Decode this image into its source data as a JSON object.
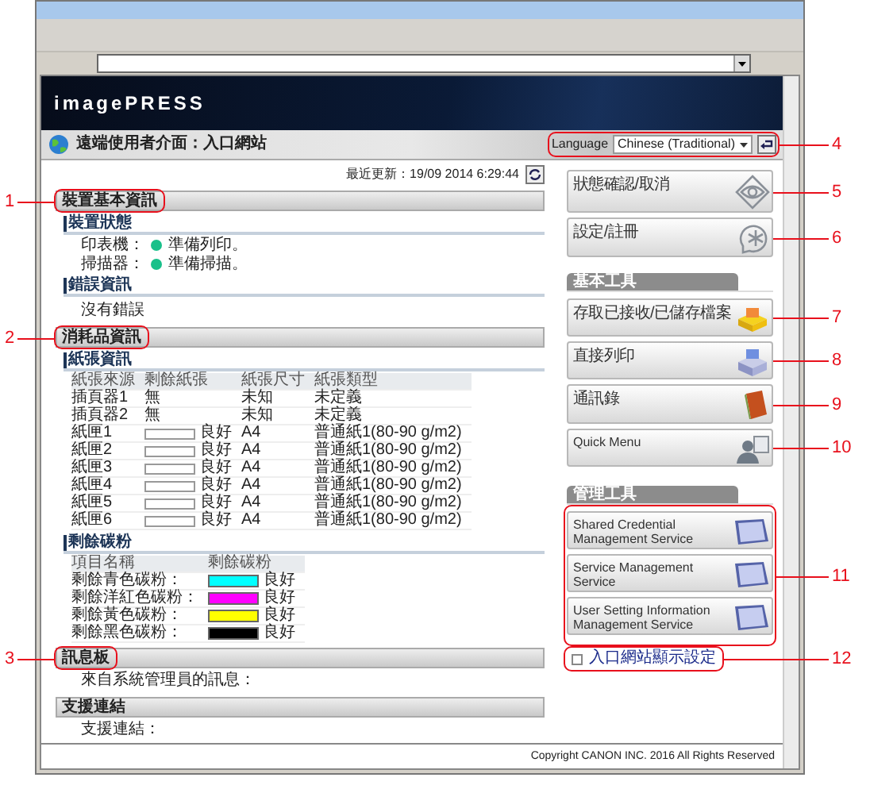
{
  "header": {
    "product": "imagePRESS",
    "title": "遠端使用者介面：入口網站",
    "language": {
      "label": "Language",
      "value": "Chinese (Traditional)",
      "callout": {
        "number": "4",
        "outlined": true
      }
    }
  },
  "last_update": "最近更新：19/09 2014 6:29:44",
  "sections": [
    {
      "title": "裝置基本資訊",
      "callout": {
        "number": "1",
        "outlined": true
      },
      "blocks": [
        {
          "kind": "status",
          "title": "裝置狀態",
          "rows": [
            {
              "label": "印表機：",
              "status": "準備列印。"
            },
            {
              "label": "掃描器：",
              "status": "準備掃描。"
            }
          ]
        },
        {
          "kind": "text",
          "title": "錯誤資訊",
          "text": "沒有錯誤"
        }
      ]
    },
    {
      "title": "消耗品資訊",
      "callout": {
        "number": "2",
        "outlined": true
      },
      "blocks": [
        {
          "kind": "paper",
          "title": "紙張資訊",
          "columns": [
            "紙張來源",
            "剩餘紙張",
            "紙張尺寸",
            "紙張類型"
          ],
          "rows": [
            {
              "source": "插頁器1",
              "remaining": "無",
              "size": "未知",
              "type": "未定義"
            },
            {
              "source": "插頁器2",
              "remaining": "無",
              "size": "未知",
              "type": "未定義"
            },
            {
              "source": "紙匣1",
              "gauge": true,
              "remaining": "良好",
              "size": "A4",
              "type": "普通紙1(80-90 g/m2)"
            },
            {
              "source": "紙匣2",
              "gauge": true,
              "remaining": "良好",
              "size": "A4",
              "type": "普通紙1(80-90 g/m2)"
            },
            {
              "source": "紙匣3",
              "gauge": true,
              "remaining": "良好",
              "size": "A4",
              "type": "普通紙1(80-90 g/m2)"
            },
            {
              "source": "紙匣4",
              "gauge": true,
              "remaining": "良好",
              "size": "A4",
              "type": "普通紙1(80-90 g/m2)"
            },
            {
              "source": "紙匣5",
              "gauge": true,
              "remaining": "良好",
              "size": "A4",
              "type": "普通紙1(80-90 g/m2)"
            },
            {
              "source": "紙匣6",
              "gauge": true,
              "remaining": "良好",
              "size": "A4",
              "type": "普通紙1(80-90 g/m2)"
            }
          ]
        },
        {
          "kind": "toner",
          "title": "剩餘碳粉",
          "columns": [
            "項目名稱",
            "剩餘碳粉"
          ],
          "rows": [
            {
              "name": "剩餘青色碳粉：",
              "color": "#00ffff",
              "level": 1,
              "status": "良好"
            },
            {
              "name": "剩餘洋紅色碳粉：",
              "color": "#ff00ff",
              "level": 1,
              "status": "良好"
            },
            {
              "name": "剩餘黃色碳粉：",
              "color": "#ffff00",
              "level": 1,
              "status": "良好"
            },
            {
              "name": "剩餘黑色碳粉：",
              "color": "#000000",
              "level": 1,
              "status": "良好"
            }
          ]
        }
      ]
    },
    {
      "title": "訊息板",
      "callout": {
        "number": "3",
        "outlined": true
      },
      "blocks": [
        {
          "kind": "plain",
          "text": "來自系統管理員的訊息："
        }
      ]
    },
    {
      "title": "支援連結",
      "blocks": [
        {
          "kind": "plain",
          "text": "支援連結："
        }
      ]
    }
  ],
  "right": {
    "buttons": [
      {
        "label": "狀態確認/取消",
        "callout": {
          "number": "5"
        }
      },
      {
        "label": "設定/註冊",
        "callout": {
          "number": "6"
        }
      }
    ],
    "groups": [
      {
        "title": "基本工具",
        "buttons": [
          {
            "label": "存取已接收/已儲存檔案",
            "callout": {
              "number": "7"
            }
          },
          {
            "label": "直接列印",
            "callout": {
              "number": "8"
            }
          },
          {
            "label": "通訊錄",
            "callout": {
              "number": "9"
            }
          },
          {
            "label": "Quick Menu",
            "callout": {
              "number": "10"
            }
          }
        ]
      },
      {
        "title": "管理工具",
        "callout": {
          "number": "11",
          "outlined": true
        },
        "buttons": [
          {
            "label": "Shared Credential Management Service"
          },
          {
            "label": "Service Management Service"
          },
          {
            "label": "User Setting Information Management Service"
          }
        ]
      }
    ],
    "link": {
      "text": "入口網站顯示設定",
      "callout": {
        "number": "12",
        "outlined": true
      }
    }
  },
  "footer": "Copyright CANON INC. 2016 All Rights Reserved"
}
